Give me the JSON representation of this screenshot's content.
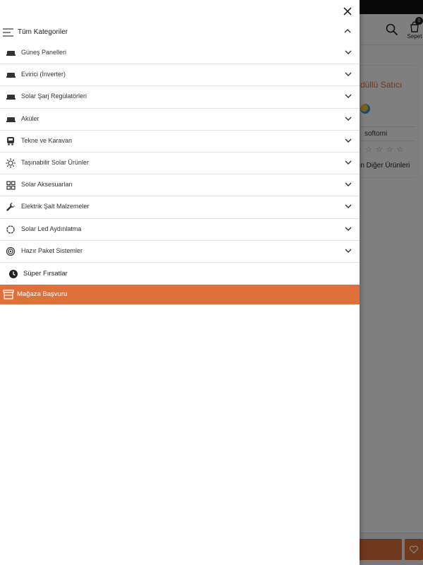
{
  "background": {
    "cart_label": "Sepet",
    "cart_count": "0",
    "seller_title": "düllü Satıcı",
    "seller_name": "softomi",
    "seller_rating_stars": "☆ ☆ ☆ ☆ ☆",
    "seller_link": "nın Diğer Ürünleri"
  },
  "drawer": {
    "header_label": "Tüm Kategoriler",
    "categories": [
      {
        "label": "Güneş Panelleri",
        "icon": "panel-icon"
      },
      {
        "label": "Evirici (İnverter)",
        "icon": "inverter-icon"
      },
      {
        "label": "Solar Şarj Regülatörleri",
        "icon": "charge-regulator-icon"
      },
      {
        "label": "Aküler",
        "icon": "battery-icon"
      },
      {
        "label": "Tekne ve Karavan",
        "icon": "caravan-icon"
      },
      {
        "label": "Taşınabilir Solar Ürünler",
        "icon": "sun-icon"
      },
      {
        "label": "Solar Aksesuarları",
        "icon": "grid-icon"
      },
      {
        "label": "Elektrik Şalt Malzemeler",
        "icon": "wrench-icon"
      },
      {
        "label": "Solar Led Aydınlatma",
        "icon": "led-ring-icon"
      },
      {
        "label": "Hazır Paket Sistemler",
        "icon": "target-icon"
      }
    ],
    "super_deals_label": "Süper Fırsatlar",
    "store_apply_label": "Mağaza Başvuru"
  },
  "colors": {
    "accent": "#e0703a",
    "overlay": "#000000",
    "divider": "#e3e3e3"
  }
}
